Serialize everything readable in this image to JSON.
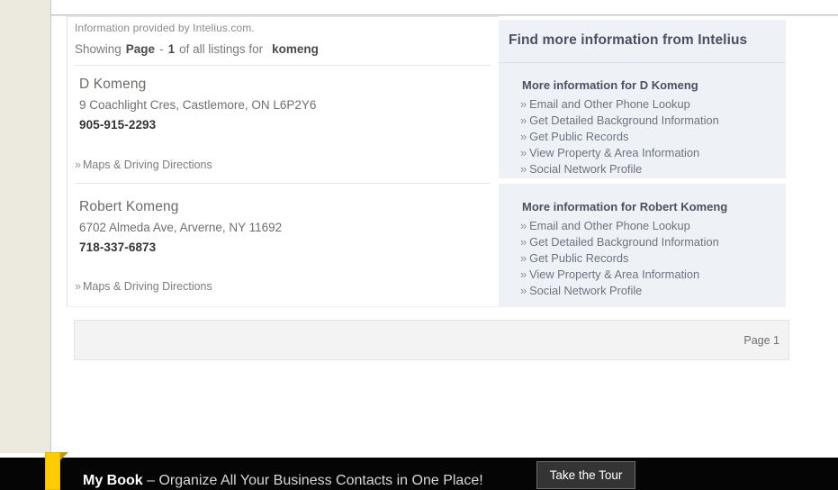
{
  "source_note": "Information provided by Intelius.com.",
  "showing": {
    "prefix": "Showing",
    "page_word": "Page",
    "dash": "-",
    "page_number": "1",
    "middle": "of all listings for",
    "query": "komeng"
  },
  "listings": [
    {
      "name": "D Komeng",
      "address": "9 Coachlight Cres, Castlemore, ON L6P2Y6",
      "phone": "905-915-2293",
      "maps_link": "Maps & Driving Directions"
    },
    {
      "name": "Robert Komeng",
      "address": "6702 Almeda Ave, Arverne, NY 11692",
      "phone": "718-337-6873",
      "maps_link": "Maps & Driving Directions"
    }
  ],
  "panel": {
    "header": "Find more information from Intelius",
    "blocks": [
      {
        "title": "More information for D Komeng",
        "links": [
          "Email and Other Phone Lookup",
          "Get Detailed Background Information",
          "Get Public Records",
          "View Property & Area Information",
          "Social Network Profile"
        ]
      },
      {
        "title": "More information for Robert Komeng",
        "links": [
          "Email and Other Phone Lookup",
          "Get Detailed Background Information",
          "Get Public Records",
          "View Property & Area Information",
          "Social Network Profile"
        ]
      }
    ]
  },
  "pager": {
    "label": "Page 1"
  },
  "promo": {
    "brand": "My Book",
    "tagline": "– Organize All Your Business Contacts in One Place!",
    "button": "Take the Tour"
  },
  "icons": {
    "chevron": "»"
  },
  "colors": {
    "gutter": "#eceade",
    "panel_bg": "#eef1f6",
    "pager_bg": "#f3f3f3",
    "promo_bg": "#050505",
    "bookmark": "#ffcb05"
  }
}
